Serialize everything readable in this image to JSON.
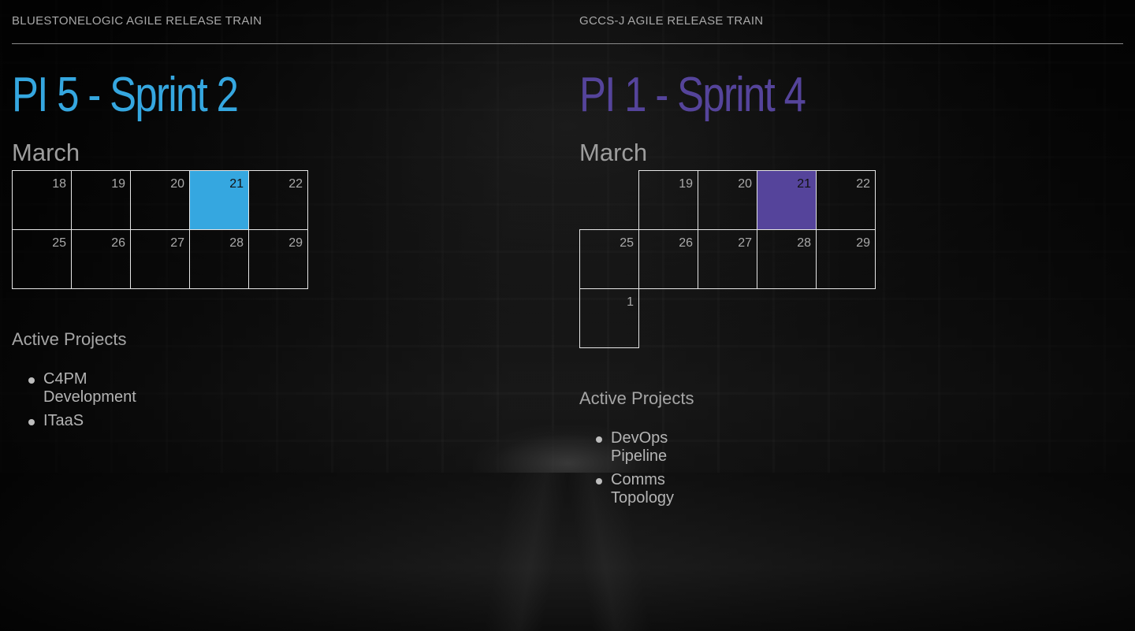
{
  "theme": {
    "left_accent": "#35a7e0",
    "right_accent": "#55449b"
  },
  "left": {
    "train_title": "BLUESTONELOGIC AGILE RELEASE TRAIN",
    "sprint_title": "PI 5 - Sprint 2",
    "month": "March",
    "calendar_days": [
      "18",
      "19",
      "20",
      "21",
      "22",
      "25",
      "26",
      "27",
      "28",
      "29"
    ],
    "highlighted_day": "21",
    "projects_heading": "Active Projects",
    "projects": [
      "C4PM Development",
      "ITaaS"
    ]
  },
  "right": {
    "train_title": "GCCS-J AGILE RELEASE TRAIN",
    "sprint_title": "PI 1 - Sprint 4",
    "month": "March",
    "calendar_days": [
      "19",
      "20",
      "21",
      "22",
      "25",
      "26",
      "27",
      "28",
      "29",
      "1"
    ],
    "highlighted_day": "21",
    "projects_heading": "Active Projects",
    "projects": [
      "DevOps Pipeline",
      "Comms Topology"
    ]
  }
}
